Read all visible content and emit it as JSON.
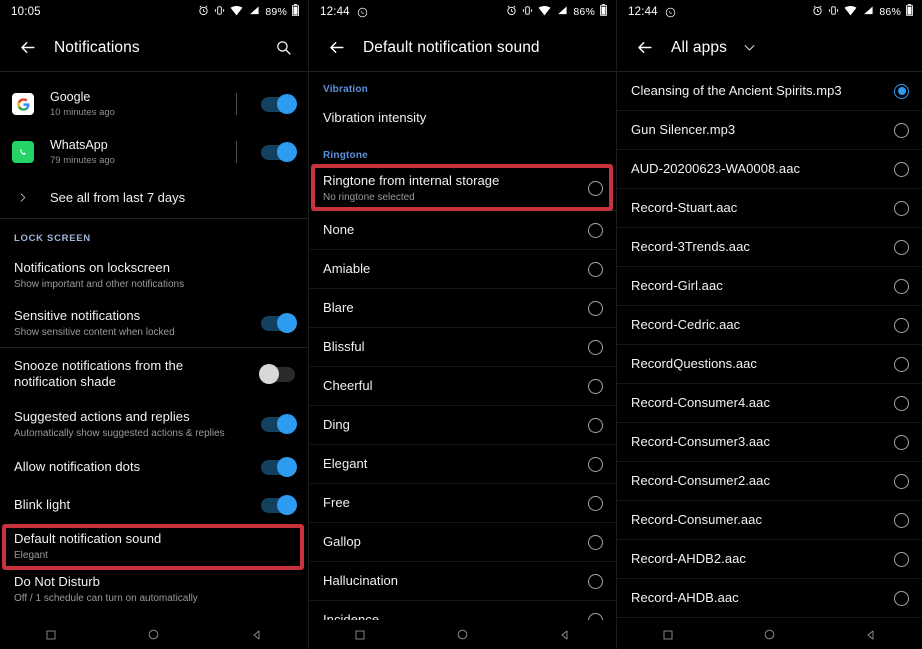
{
  "panel1": {
    "status_bar": {
      "time": "10:05",
      "battery_text": "89%",
      "icons": [
        "alarm-icon",
        "vibrate-icon",
        "wifi-icon",
        "signal-icon",
        "battery-icon"
      ]
    },
    "app_bar": {
      "title": "Notifications",
      "back_icon": "back-arrow-icon",
      "search_icon": "search-icon"
    },
    "notifications": [
      {
        "app": "Google",
        "time": "10 minutes ago",
        "icon": "google-icon",
        "toggle": "on"
      },
      {
        "app": "WhatsApp",
        "time": "79 minutes ago",
        "icon": "whatsapp-icon",
        "toggle": "on"
      }
    ],
    "see_all_label": "See all from last 7 days",
    "lock_screen_header": "LOCK SCREEN",
    "settings": [
      {
        "title": "Notifications on lockscreen",
        "subtitle": "Show important and other notifications",
        "toggle": "none"
      },
      {
        "title": "Sensitive notifications",
        "subtitle": "Show sensitive content when locked",
        "toggle": "on"
      },
      {
        "title": "Snooze notifications from the notification shade",
        "subtitle": "",
        "toggle": "off"
      },
      {
        "title": "Suggested actions and replies",
        "subtitle": "Automatically show suggested actions & replies",
        "toggle": "on"
      },
      {
        "title": "Allow notification dots",
        "subtitle": "",
        "toggle": "on"
      },
      {
        "title": "Blink light",
        "subtitle": "",
        "toggle": "on"
      },
      {
        "title": "Default notification sound",
        "subtitle": "Elegant",
        "toggle": "none",
        "highlighted": true
      },
      {
        "title": "Do Not Disturb",
        "subtitle": "Off / 1 schedule can turn on automatically",
        "toggle": "none"
      }
    ]
  },
  "panel2": {
    "status_bar": {
      "time": "12:44",
      "battery_text": "86%",
      "icons": [
        "whatsapp-status-icon",
        "alarm-icon",
        "vibrate-icon",
        "wifi-icon",
        "signal-icon",
        "battery-icon"
      ]
    },
    "app_bar": {
      "title": "Default notification sound",
      "back_icon": "back-arrow-icon"
    },
    "vibration_header": "Vibration",
    "vibration_item": "Vibration intensity",
    "ringtone_header": "Ringtone",
    "internal_storage": {
      "title": "Ringtone from internal storage",
      "subtitle": "No ringtone selected",
      "selected": false,
      "highlighted": true
    },
    "ringtones": [
      {
        "name": "None",
        "selected": false
      },
      {
        "name": "Amiable",
        "selected": false
      },
      {
        "name": "Blare",
        "selected": false
      },
      {
        "name": "Blissful",
        "selected": false
      },
      {
        "name": "Cheerful",
        "selected": false
      },
      {
        "name": "Ding",
        "selected": false
      },
      {
        "name": "Elegant",
        "selected": false
      },
      {
        "name": "Free",
        "selected": false
      },
      {
        "name": "Gallop",
        "selected": false
      },
      {
        "name": "Hallucination",
        "selected": false
      },
      {
        "name": "Incidence",
        "selected": false
      }
    ]
  },
  "panel3": {
    "status_bar": {
      "time": "12:44",
      "battery_text": "86%",
      "icons": [
        "whatsapp-status-icon",
        "alarm-icon",
        "vibrate-icon",
        "wifi-icon",
        "signal-icon",
        "battery-icon"
      ]
    },
    "app_bar": {
      "title": "All apps",
      "back_icon": "back-arrow-icon",
      "dropdown_icon": "chevron-down-icon"
    },
    "files": [
      {
        "name": "Cleansing of the Ancient Spirits.mp3",
        "selected": true
      },
      {
        "name": "Gun Silencer.mp3",
        "selected": false
      },
      {
        "name": "AUD-20200623-WA0008.aac",
        "selected": false
      },
      {
        "name": "Record-Stuart.aac",
        "selected": false
      },
      {
        "name": "Record-3Trends.aac",
        "selected": false
      },
      {
        "name": "Record-Girl.aac",
        "selected": false
      },
      {
        "name": "Record-Cedric.aac",
        "selected": false
      },
      {
        "name": "RecordQuestions.aac",
        "selected": false
      },
      {
        "name": "Record-Consumer4.aac",
        "selected": false
      },
      {
        "name": "Record-Consumer3.aac",
        "selected": false
      },
      {
        "name": "Record-Consumer2.aac",
        "selected": false
      },
      {
        "name": "Record-Consumer.aac",
        "selected": false
      },
      {
        "name": "Record-AHDB2.aac",
        "selected": false
      },
      {
        "name": "Record-AHDB.aac",
        "selected": false
      }
    ]
  },
  "nav_bar": {
    "square": "recents-icon",
    "circle": "home-icon",
    "triangle": "back-nav-icon"
  },
  "colors": {
    "accent": "#2d9bf0",
    "highlight": "#c8323c",
    "section_blue": "#5b8fd9",
    "background": "#000000"
  }
}
